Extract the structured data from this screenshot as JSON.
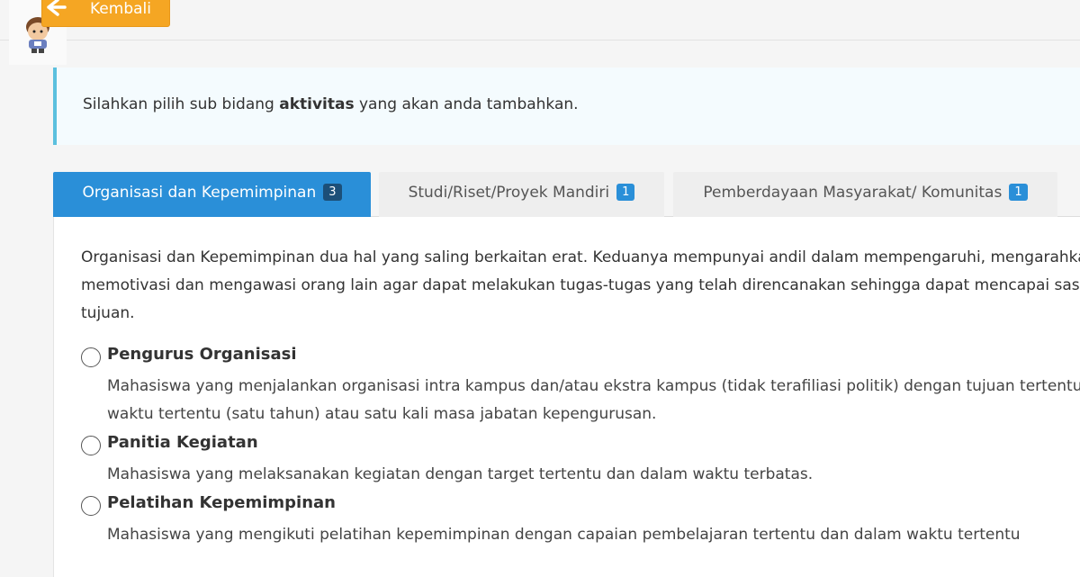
{
  "header": {
    "back_label": "Kembali"
  },
  "info": {
    "prefix": "Silahkan pilih sub bidang ",
    "highlight": "aktivitas",
    "suffix": " yang akan anda tambahkan."
  },
  "tabs": [
    {
      "label": "Organisasi dan Kepemimpinan",
      "count": "3"
    },
    {
      "label": "Studi/Riset/Proyek Mandiri",
      "count": "1"
    },
    {
      "label": "Pemberdayaan Masyarakat/ Komunitas",
      "count": "1"
    }
  ],
  "panel": {
    "description_lines": [
      "Organisasi dan Kepemimpinan dua hal yang saling berkaitan erat. Keduanya mempunyai andil dalam mempengaruhi, mengarahkan,",
      "memotivasi dan mengawasi orang lain agar dapat melakukan tugas-tugas yang telah direncanakan sehingga dapat mencapai sasaran",
      "tujuan."
    ],
    "options": [
      {
        "title": "Pengurus Organisasi",
        "desc_lines": [
          "Mahasiswa yang menjalankan organisasi intra kampus dan/atau ekstra kampus (tidak terafiliasi politik) dengan tujuan tertentu",
          "waktu tertentu (satu tahun) atau satu kali masa jabatan kepengurusan."
        ]
      },
      {
        "title": "Panitia Kegiatan",
        "desc_lines": [
          "Mahasiswa yang melaksanakan kegiatan dengan target tertentu dan dalam waktu terbatas."
        ]
      },
      {
        "title": "Pelatihan Kepemimpinan",
        "desc_lines": [
          "Mahasiswa yang mengikuti pelatihan kepemimpinan dengan capaian pembelajaran tertentu dan dalam waktu tertentu"
        ]
      }
    ]
  },
  "colors": {
    "accent_blue": "#2a8fd8",
    "back_orange": "#f5a623",
    "info_border": "#5bc0de"
  }
}
